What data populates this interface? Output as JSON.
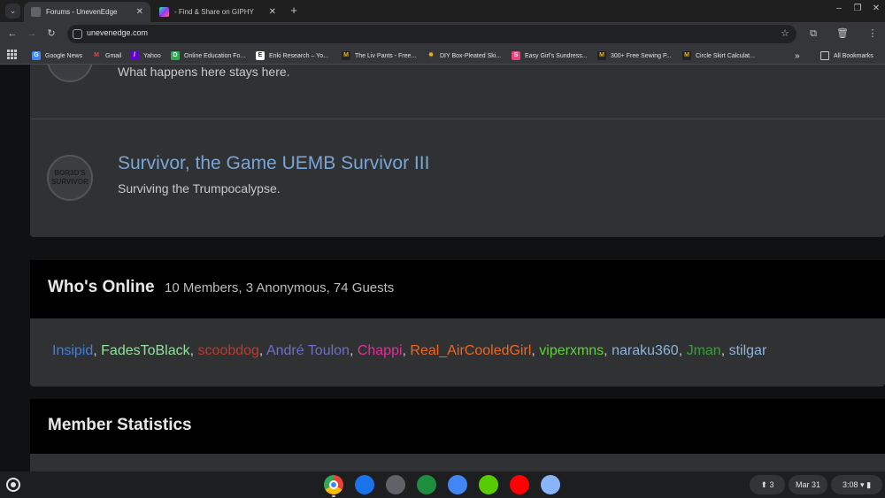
{
  "browser": {
    "tabs": [
      {
        "title": "Forums - UnevenEdge",
        "favicon_color": "#5f6368",
        "active": true
      },
      {
        "title": "- Find & Share on GIPHY",
        "favicon_color": "#a855f7",
        "active": false
      }
    ],
    "address": "unevenedge.com",
    "bookmarks": [
      {
        "label": "Google News",
        "icon": "G",
        "color": "#4285f4"
      },
      {
        "label": "Gmail",
        "icon": "M",
        "color": "#ea4335"
      },
      {
        "label": "Yahoo",
        "icon": "/",
        "color": "#6001d2"
      },
      {
        "label": "Online Education Fo...",
        "icon": "D",
        "color": "#34a853"
      },
      {
        "label": "Enki Research – Yo...",
        "icon": "E",
        "color": "#ffffff"
      },
      {
        "label": "The Liv Pants - Free...",
        "icon": "M",
        "color": "#222222"
      },
      {
        "label": "DIY Box-Pleated Ski...",
        "icon": "✸",
        "color": "#f2b400"
      },
      {
        "label": "Easy Girl's Sundress...",
        "icon": "S",
        "color": "#e8457a"
      },
      {
        "label": "300+ Free Sewing P...",
        "icon": "M",
        "color": "#222222"
      },
      {
        "label": "Circle Skirt Calculat...",
        "icon": "M",
        "color": "#222222"
      }
    ],
    "overflow": "»",
    "all_bookmarks": "All Bookmarks"
  },
  "forums": [
    {
      "title": "",
      "description": "What happens here stays here."
    },
    {
      "title": "Survivor, the Game UEMB Survivor III",
      "description": "Surviving the Trumpocalypse.",
      "avatar_text": "BOR3D'S SURVIVOR"
    }
  ],
  "whos_online": {
    "heading": "Who's Online",
    "stats": "10 Members, 3 Anonymous, 74 Guests",
    "members": [
      {
        "name": "Insipid",
        "color": "#3f7fe0"
      },
      {
        "name": "FadesToBlack",
        "color": "#8fe39a"
      },
      {
        "name": "scoobdog",
        "color": "#c0392b"
      },
      {
        "name": "André Toulon",
        "color": "#6e6fc9"
      },
      {
        "name": "Chappi",
        "color": "#e0319a"
      },
      {
        "name": "Real_AirCooledGirl",
        "color": "#f0651e"
      },
      {
        "name": "viperxmns",
        "color": "#5fd23a"
      },
      {
        "name": "naraku360",
        "color": "#8fb4de"
      },
      {
        "name": "Jman",
        "color": "#2ea52e"
      },
      {
        "name": "stilgar",
        "color": "#8fb4de"
      }
    ]
  },
  "member_statistics": {
    "heading": "Member Statistics"
  },
  "shelf": {
    "apps": [
      {
        "name": "chrome-app",
        "color": "#e33b2e"
      },
      {
        "name": "files-app",
        "color": "#1a73e8"
      },
      {
        "name": "settings-app",
        "color": "#5f6368"
      },
      {
        "name": "calendar-app",
        "color": "#1e8e3e"
      },
      {
        "name": "docs-app",
        "color": "#4285f4"
      },
      {
        "name": "duolingo-app",
        "color": "#58cc02"
      },
      {
        "name": "youtube-app",
        "color": "#ff0000"
      },
      {
        "name": "web-app",
        "color": "#8ab4f8"
      }
    ],
    "notifications": "3",
    "date": "Mar 31",
    "time": "3:08"
  }
}
